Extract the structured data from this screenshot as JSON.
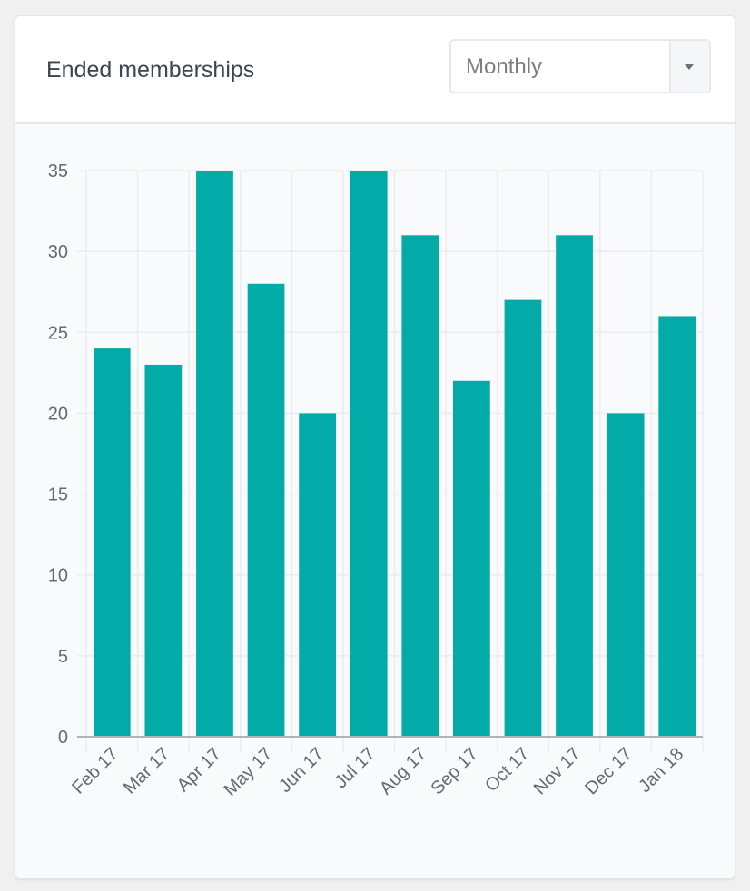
{
  "card": {
    "title": "Ended memberships",
    "period_select": {
      "value": "Monthly",
      "icon": "caret-down-icon"
    }
  },
  "colors": {
    "bar": "#02aba7",
    "grid": "#ececee",
    "axis": "#b0b3b7",
    "tick_text": "#666a6f"
  },
  "chart_data": {
    "type": "bar",
    "title": "Ended memberships",
    "xlabel": "",
    "ylabel": "",
    "categories": [
      "Feb 17",
      "Mar 17",
      "Apr 17",
      "May 17",
      "Jun 17",
      "Jul 17",
      "Aug 17",
      "Sep 17",
      "Oct 17",
      "Nov 17",
      "Dec 17",
      "Jan 18"
    ],
    "values": [
      24,
      23,
      35,
      28,
      20,
      35,
      31,
      22,
      27,
      31,
      20,
      26
    ],
    "ylim": [
      0,
      35
    ],
    "yticks": [
      0,
      5,
      10,
      15,
      20,
      25,
      30,
      35
    ],
    "grid": true,
    "legend": "none"
  }
}
